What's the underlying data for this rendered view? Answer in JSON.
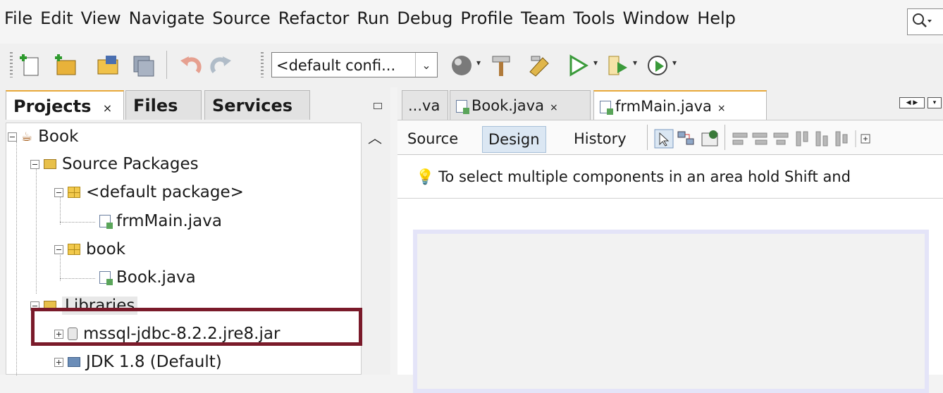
{
  "menu": [
    "File",
    "Edit",
    "View",
    "Navigate",
    "Source",
    "Refactor",
    "Run",
    "Debug",
    "Profile",
    "Team",
    "Tools",
    "Window",
    "Help"
  ],
  "toolbar": {
    "config_value": "<default confi...",
    "icons": [
      "new-file-icon",
      "new-project-icon",
      "open-project-icon",
      "save-all-icon",
      "undo-icon",
      "redo-icon",
      "globe-icon",
      "build-hammer-icon",
      "clean-build-icon",
      "run-icon",
      "debug-icon",
      "profile-icon"
    ]
  },
  "projects_panel": {
    "tabs": [
      {
        "label": "Projects",
        "close": "×"
      },
      {
        "label": "Files"
      },
      {
        "label": "Services"
      }
    ],
    "tree": {
      "root": "Book",
      "source_packages": "Source Packages",
      "default_package": "<default package>",
      "frmmain": "frmMain.java",
      "book_package": "book",
      "book_java": "Book.java",
      "libraries": "Libraries",
      "mssql_jar": "mssql-jdbc-8.2.2.jre8.jar",
      "jdk": "JDK 1.8 (Default)"
    }
  },
  "editor": {
    "tabs": [
      {
        "label": "...va"
      },
      {
        "label": "Book.java",
        "close": "×"
      },
      {
        "label": "frmMain.java",
        "close": "×"
      }
    ],
    "views": [
      "Source",
      "Design",
      "History"
    ],
    "active_view": "Design",
    "hint": "To select multiple components in an area hold Shift and"
  },
  "colors": {
    "highlight_box": "#7a1a2a",
    "active_tab_accent": "#e8a93a"
  }
}
